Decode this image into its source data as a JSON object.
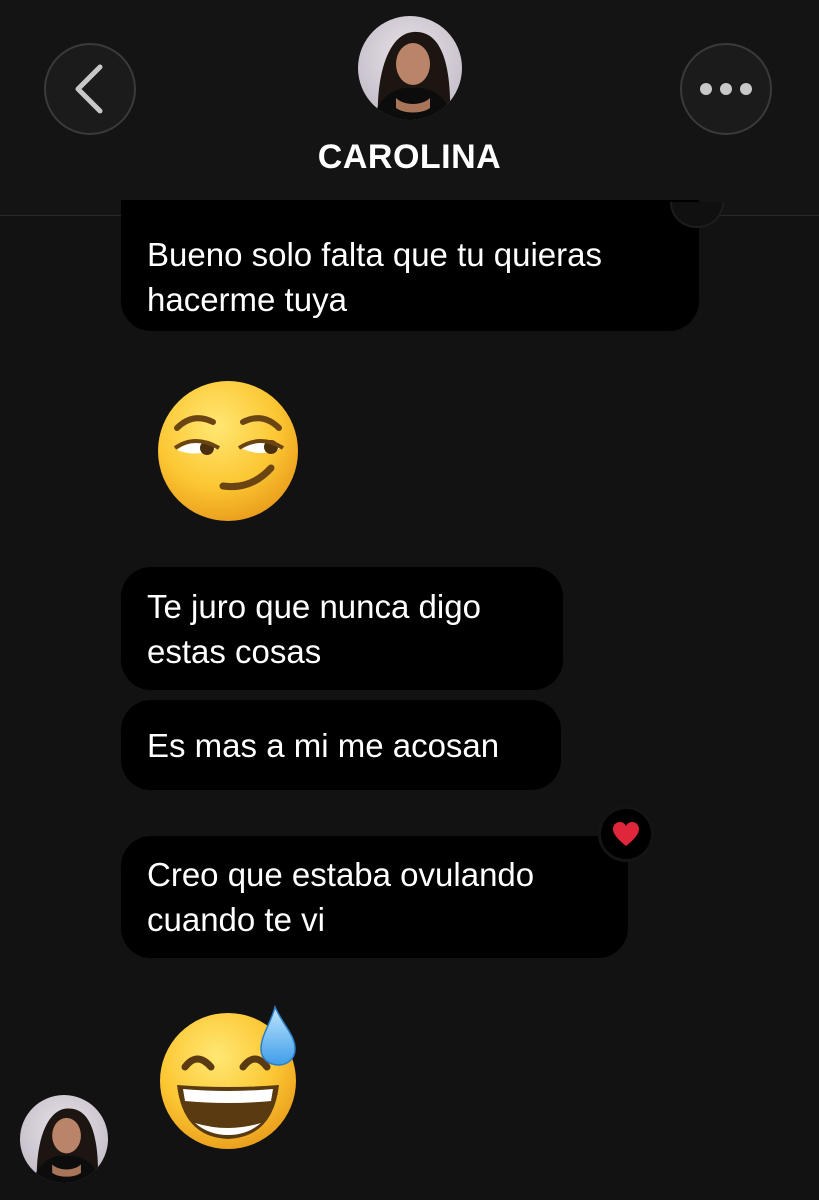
{
  "header": {
    "contact_name": "CAROLINA",
    "back_icon": "chevron-left-icon",
    "more_icon": "more-horizontal-icon"
  },
  "messages": [
    {
      "type": "text",
      "lines": [
        "Bueno solo falta que tu quieras",
        "hacerme tuya"
      ]
    },
    {
      "type": "emoji",
      "emoji": "smirking-face"
    },
    {
      "type": "text",
      "lines": [
        "Te juro que nunca digo",
        "estas cosas"
      ]
    },
    {
      "type": "text",
      "lines": [
        "Es mas a mi me acosan"
      ]
    },
    {
      "type": "text",
      "lines": [
        "Creo que estaba ovulando",
        "cuando te vi"
      ],
      "reaction": "heart-icon"
    },
    {
      "type": "emoji",
      "emoji": "grinning-face-with-sweat"
    }
  ],
  "colors": {
    "background": "#121212",
    "bubble": "#000000",
    "text": "#ffffff",
    "heart": "#e0263a"
  }
}
